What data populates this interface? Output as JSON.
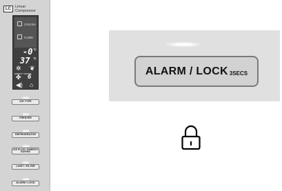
{
  "panel": {
    "badge_text": "LC",
    "brand_line1": "Linear",
    "brand_line2": "Compressor",
    "display": {
      "crushed_label": "CRUSH",
      "cubed_label": "CUBE",
      "freezer_temp": "-0",
      "freezer_unit": "°F",
      "fridge_temp": "37",
      "fridge_unit": "°F",
      "eco_label": "ENERGY SAVING",
      "filter_value": "6"
    },
    "buttons": [
      {
        "label": "ICE TYPE"
      },
      {
        "label": "FREEZER"
      },
      {
        "label": "REFRIGERATOR"
      },
      {
        "label": "ICE PLUS / ENERGY SAVING"
      },
      {
        "label": "LIGHT / FILTER"
      },
      {
        "label": "ALARM / LOCK"
      }
    ]
  },
  "zoom": {
    "button_label": "ALARM / LOCK",
    "button_sublabel": "3SECS"
  },
  "icons": {
    "lock": "padlock-icon"
  }
}
